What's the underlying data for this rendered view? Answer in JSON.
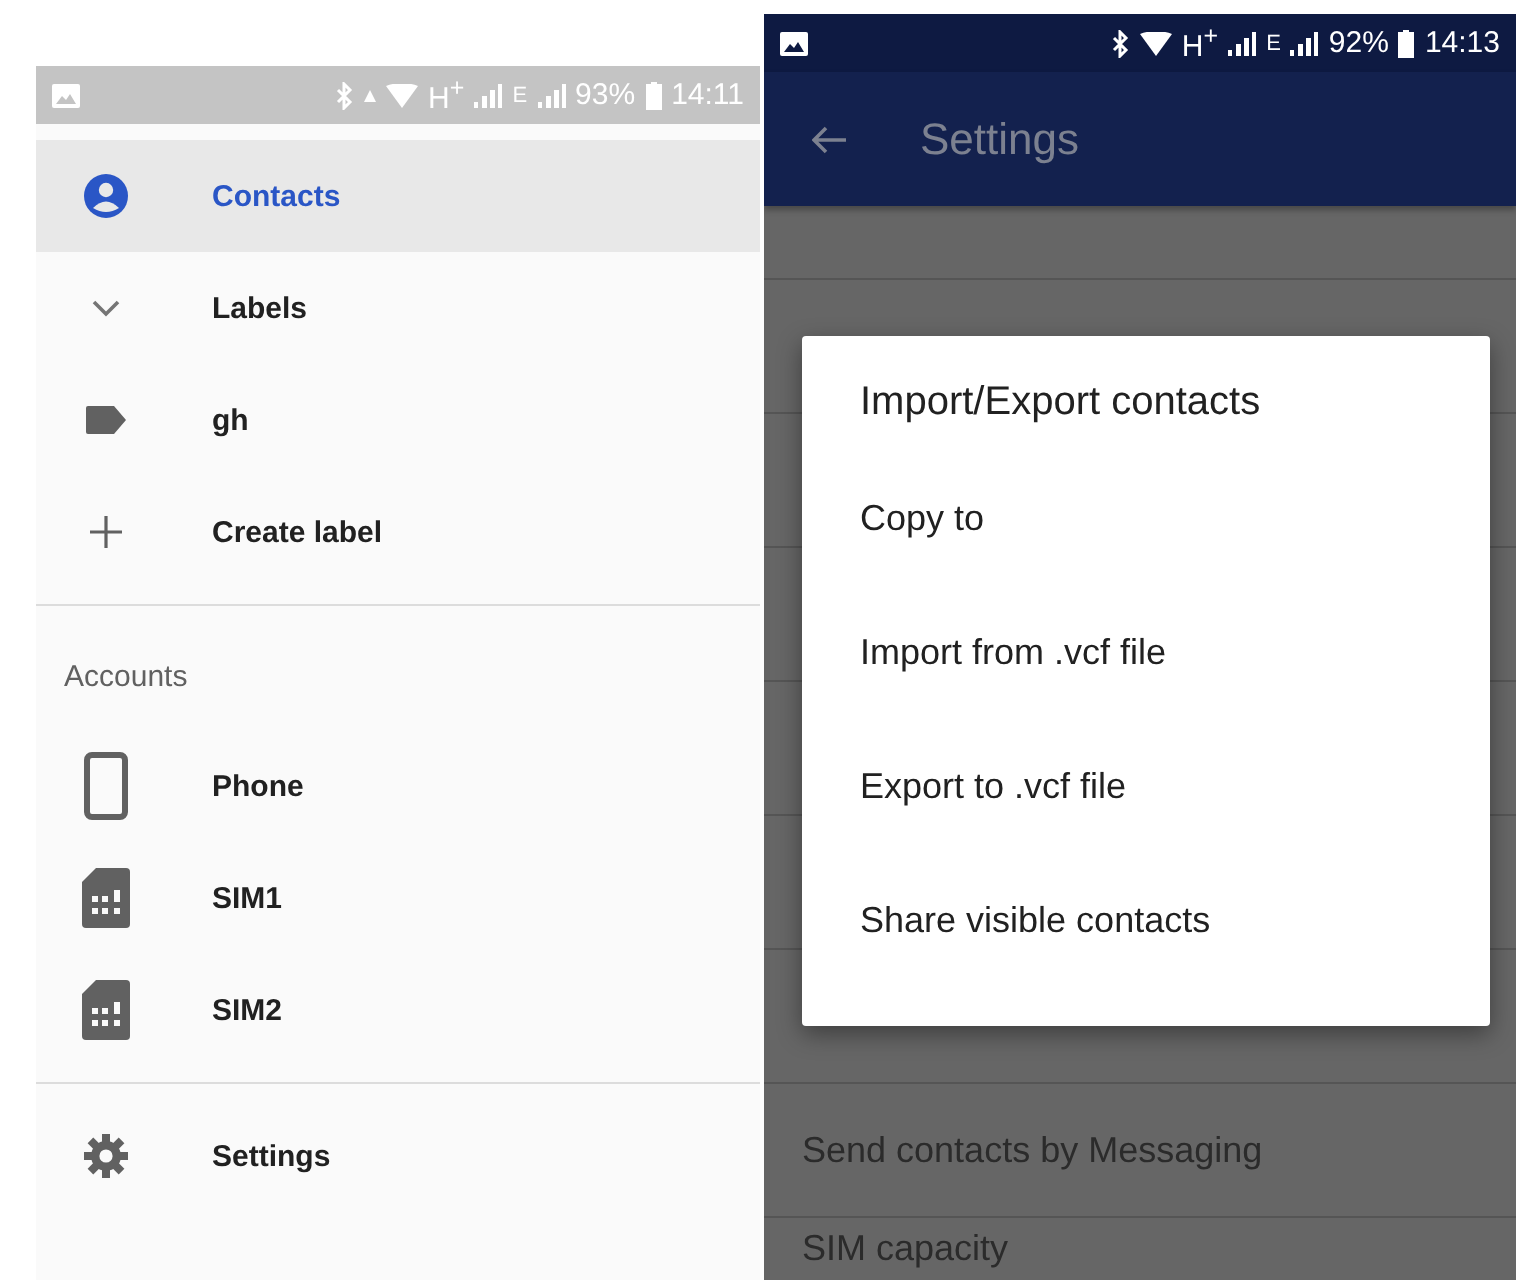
{
  "left_screen": {
    "status_bar": {
      "network": "H$^{+}$",
      "network_2": "E",
      "battery": "93%",
      "time": "14:11"
    },
    "drawer_items": [
      {
        "kind": "account",
        "label": "Contacts",
        "selected": true
      },
      {
        "kind": "group",
        "label": "Labels",
        "selected": false
      },
      {
        "kind": "label",
        "label": "gh",
        "selected": false
      },
      {
        "kind": "add",
        "label": "Create label",
        "selected": false
      }
    ],
    "accounts": {
      "heading": "Accounts",
      "items": [
        {
          "kind": "phone",
          "label": "Phone",
          "selected": false
        },
        {
          "kind": "sim",
          "label": "SIM1",
          "selected": false
        },
        {
          "kind": "sim",
          "label": "SIM2",
          "selected": false
        }
      ]
    },
    "footer_items": [
      {
        "kind": "settings",
        "label": "Settings",
        "selected": false
      }
    ]
  },
  "right_screen": {
    "status_bar": {
      "network": "H$^{+}$",
      "network_2": "E",
      "battery": "92%",
      "time": "14:13"
    },
    "app_bar": {
      "title": "Settings"
    },
    "settings_rows_bottom": [
      "Send contacts by Messaging",
      "SIM capacity"
    ],
    "dialog": {
      "title": "Import/Export contacts",
      "options": [
        "Copy to",
        "Import from .vcf file",
        "Export to .vcf file",
        "Share visible contacts"
      ]
    }
  }
}
